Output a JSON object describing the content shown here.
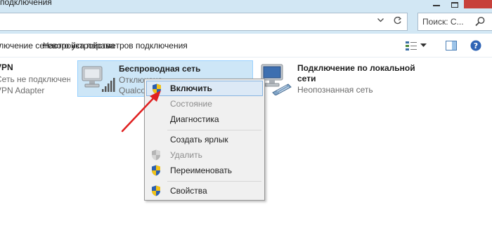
{
  "window": {
    "title": "подключения"
  },
  "address": {
    "search_placeholder": "Поиск: С..."
  },
  "commands": {
    "cmd1": "Отключение сетевого устройства",
    "cmd2": "Настройка параметров подключения"
  },
  "connections": [
    {
      "name": "VPN",
      "status": "Сеть не подключена",
      "adapter": "VPN Adapter"
    },
    {
      "name": "Беспроводная сеть",
      "status": "Отключено",
      "adapter": "Qualcomm"
    },
    {
      "name": "Подключение по локальной",
      "name_line2": "сети",
      "status": "Неопознанная сеть"
    }
  ],
  "context_menu": {
    "items": [
      {
        "label": "Включить",
        "icon": "shield-icon",
        "state": "highlighted"
      },
      {
        "label": "Состояние",
        "state": "disabled"
      },
      {
        "label": "Диагностика",
        "state": "normal"
      },
      {
        "label": "Создать ярлык",
        "state": "normal"
      },
      {
        "label": "Удалить",
        "icon": "shield-icon",
        "state": "disabled"
      },
      {
        "label": "Переименовать",
        "icon": "shield-icon",
        "state": "normal"
      },
      {
        "label": "Свойства",
        "icon": "shield-icon",
        "state": "normal"
      }
    ]
  },
  "colors": {
    "chrome": "#d2e7f4",
    "selection": "#cde6f7",
    "close_button": "#c7403a",
    "arrow": "#e02020"
  }
}
